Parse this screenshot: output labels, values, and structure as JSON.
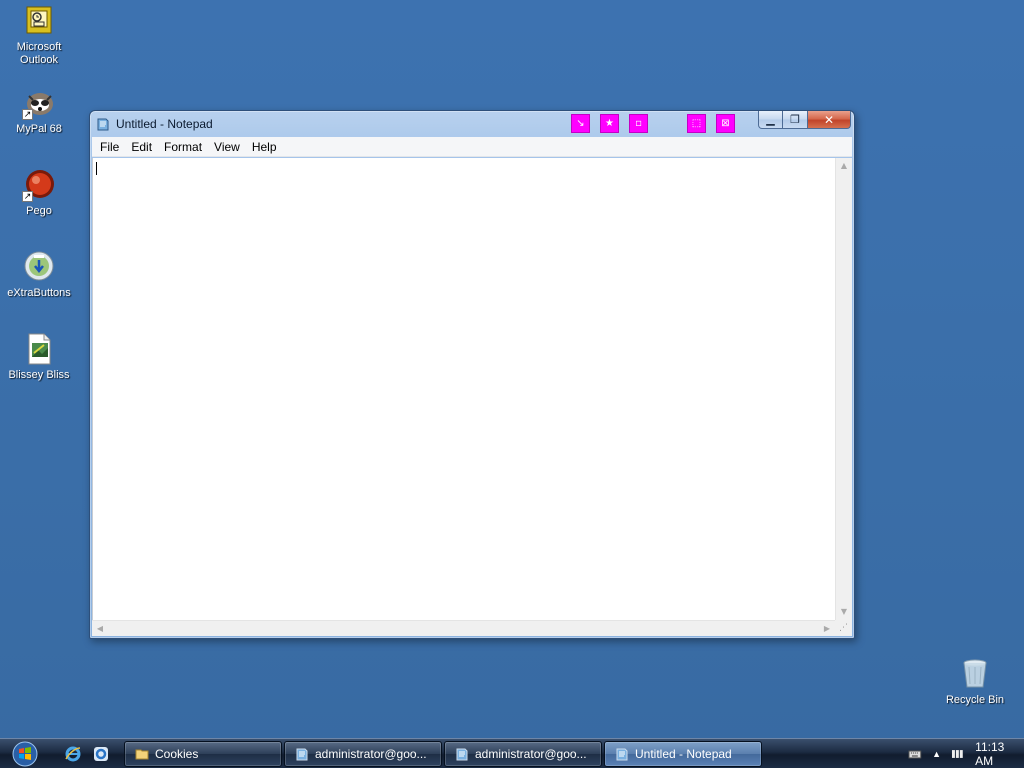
{
  "desktop": {
    "icons": [
      {
        "label": "Microsoft Outlook",
        "icon": "outlook-icon"
      },
      {
        "label": "MyPal 68",
        "icon": "mypal-icon"
      },
      {
        "label": "Pego",
        "icon": "pego-icon"
      },
      {
        "label": "eXtraButtons",
        "icon": "extrabuttons-icon"
      },
      {
        "label": "Blissey Bliss",
        "icon": "image-file-icon"
      }
    ],
    "recycle_bin": {
      "label": "Recycle Bin",
      "icon": "recycle-bin-icon"
    }
  },
  "window": {
    "title": "Untitled - Notepad",
    "icon": "notepad-icon",
    "extra_buttons": [
      "move-down-icon",
      "star-icon",
      "minimize-to-tray-icon",
      "roll-up-icon",
      "transparency-icon"
    ],
    "caption": {
      "minimize": "minimize-icon",
      "maximize": "maximize-icon",
      "close": "close-icon"
    },
    "menu": [
      "File",
      "Edit",
      "Format",
      "View",
      "Help"
    ],
    "content": ""
  },
  "taskbar": {
    "start": "windows-start-orb-icon",
    "quick_launch": [
      "internet-explorer-icon",
      "ie-alt-icon"
    ],
    "buttons": [
      {
        "label": "Cookies",
        "icon": "folder-icon",
        "active": false
      },
      {
        "label": "administrator@goo...",
        "icon": "notepad-icon",
        "active": false
      },
      {
        "label": "administrator@goo...",
        "icon": "notepad-icon",
        "active": false
      },
      {
        "label": "Untitled - Notepad",
        "icon": "notepad-icon",
        "active": true
      }
    ],
    "tray": {
      "clock": "11:13 AM",
      "icons": [
        "keyboard-icon",
        "show-hidden-icon",
        "network-icon"
      ]
    }
  },
  "colors": {
    "desktop": "#3a6ea5",
    "magenta": "#ff00ff",
    "close": "#c1442a"
  }
}
